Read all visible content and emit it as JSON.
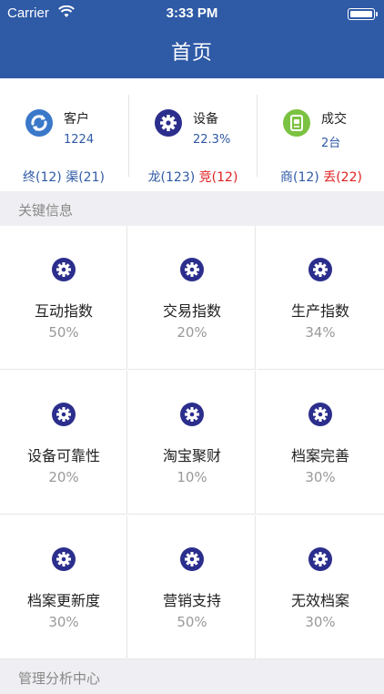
{
  "status_bar": {
    "carrier": "Carrier",
    "time": "3:33 PM"
  },
  "nav": {
    "title": "首页"
  },
  "summary": [
    {
      "icon": "refresh-icon",
      "label": "客户",
      "value": "1224",
      "foot": [
        {
          "text": "终(12)",
          "color": "#2f5aa6"
        },
        {
          "text": "渠(21)",
          "color": "#2f5aa6"
        }
      ]
    },
    {
      "icon": "gear-icon",
      "label": "设备",
      "value": "22.3%",
      "foot": [
        {
          "text": "龙(123)",
          "color": "#2f5aa6"
        },
        {
          "text": "竞(12)",
          "color": "#e02020"
        }
      ]
    },
    {
      "icon": "document-icon",
      "label": "成交",
      "value": "2台",
      "foot": [
        {
          "text": "商(12)",
          "color": "#2f5aa6"
        },
        {
          "text": "丢(22)",
          "color": "#e02020"
        }
      ]
    }
  ],
  "sections": {
    "key_info": "关键信息",
    "management": "管理分析中心"
  },
  "metrics": [
    {
      "label": "互动指数",
      "value": "50%"
    },
    {
      "label": "交易指数",
      "value": "20%"
    },
    {
      "label": "生产指数",
      "value": "34%"
    },
    {
      "label": "设备可靠性",
      "value": "20%"
    },
    {
      "label": "淘宝聚财",
      "value": "10%"
    },
    {
      "label": "档案完善",
      "value": "30%"
    },
    {
      "label": "档案更新度",
      "value": "30%"
    },
    {
      "label": "营销支持",
      "value": "50%"
    },
    {
      "label": "无效档案",
      "value": "30%"
    }
  ],
  "colors": {
    "brand": "#2f5aa6",
    "icon_gear": "#2b2e8c",
    "icon_refresh": "#3a78c9",
    "icon_doc": "#7cc242",
    "alert": "#e02020"
  }
}
